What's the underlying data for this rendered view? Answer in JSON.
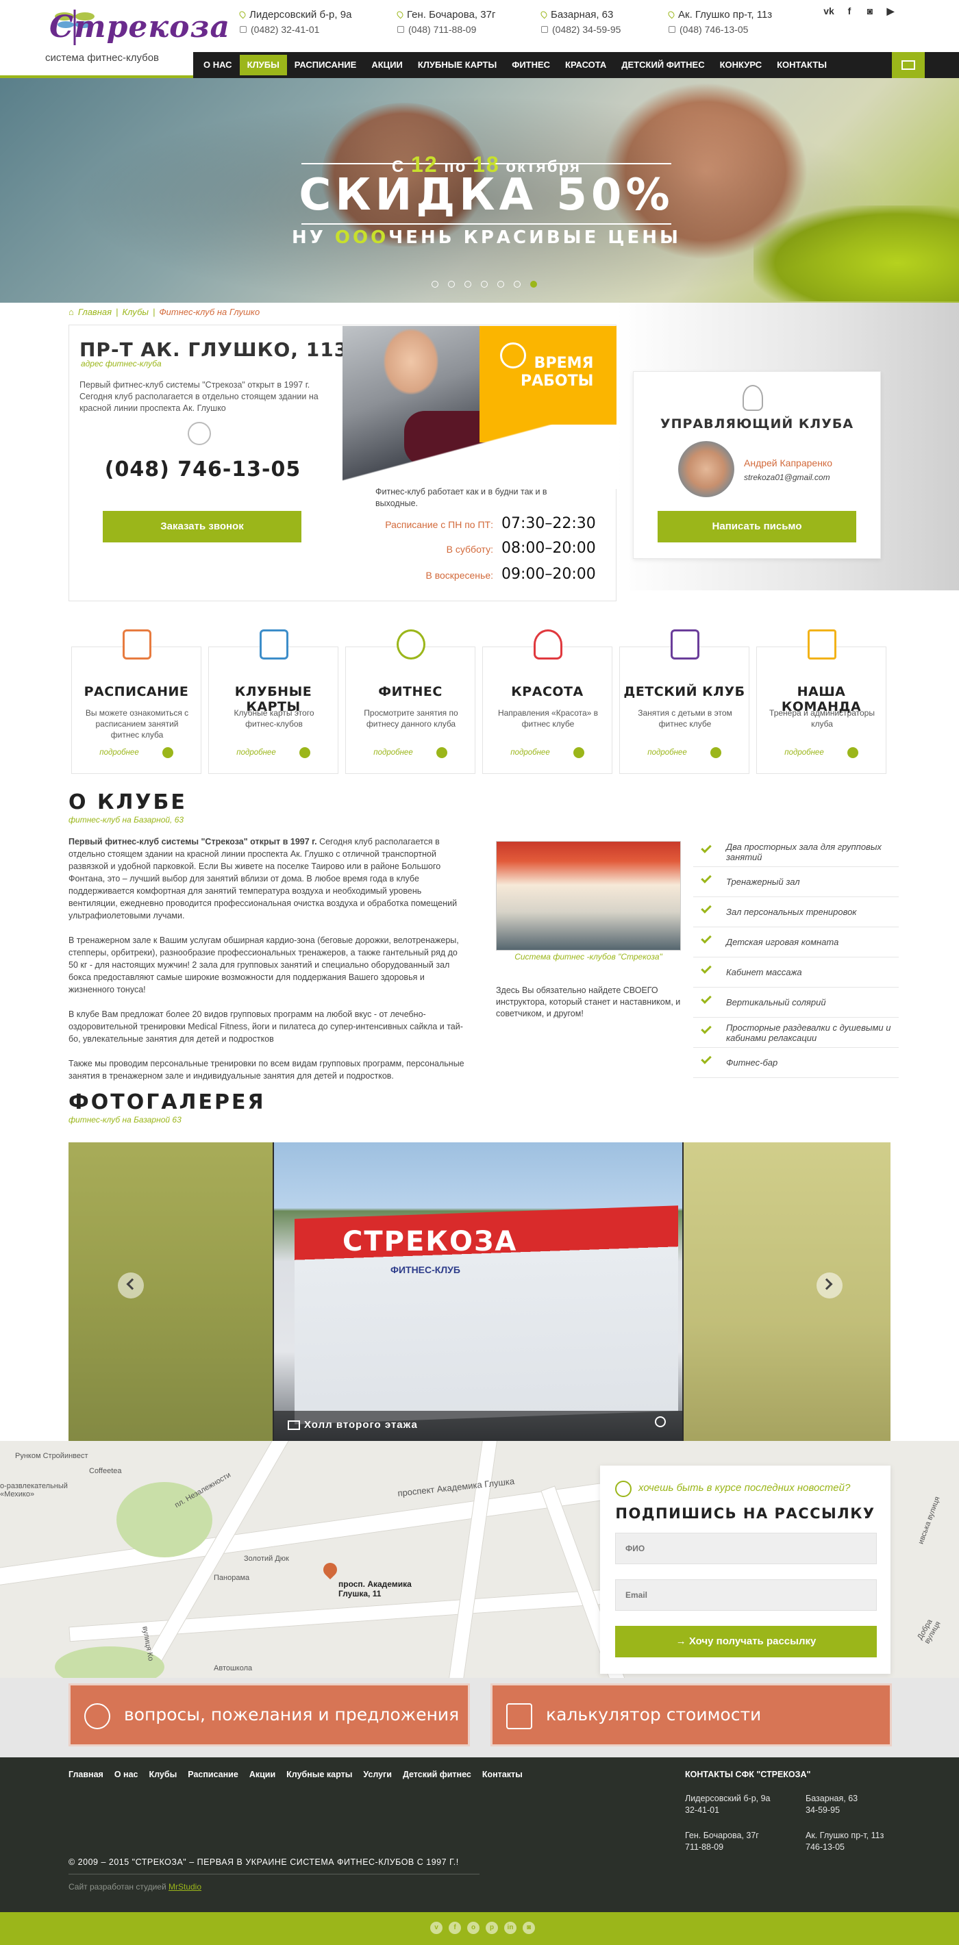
{
  "brand": {
    "name": "Стрекоза",
    "tagline": "система фитнес-клубов",
    "accent": "#9bb61a",
    "orange": "#d2693a"
  },
  "addresses": [
    {
      "street": "Лидерсовский б-р, 9а",
      "phone": "(0482) 32-41-01"
    },
    {
      "street": "Ген. Бочарова, 37г",
      "phone": "(048) 711-88-09"
    },
    {
      "street": "Базарная, 63",
      "phone": "(0482) 34-59-95"
    },
    {
      "street": "Ак. Глушко пр-т, 11з",
      "phone": "(048) 746-13-05"
    }
  ],
  "socials": [
    "vk-icon",
    "facebook-icon",
    "instagram-icon",
    "youtube-icon"
  ],
  "nav": [
    "О нас",
    "Клубы",
    "Расписание",
    "Акции",
    "Клубные карты",
    "Фитнес",
    "Красота",
    "Детский фитнес",
    "Конкурс",
    "Контакты"
  ],
  "nav_active": "Клубы",
  "hero": {
    "date_prefix": "С",
    "date_from": "12",
    "date_mid": "по",
    "date_to": "18",
    "date_month": "октября",
    "title": "СКИДКА 50%",
    "sub_pre": "НУ ",
    "sub_accent": "ООО",
    "sub_post": "ЧЕНЬ КРАСИВЫЕ ЦЕНЫ",
    "slides": 7,
    "active_slide": 7
  },
  "breadcrumb": {
    "home": "Главная",
    "clubs": "Клубы",
    "current": "Фитнес-клуб на Глушко"
  },
  "club": {
    "title": "ПР-Т АК. ГЛУШКО, 113",
    "addr_label": "адрес фитнес-клуба",
    "desc": "Первый фитнес-клуб системы \"Стрекоза\" открыт в 1997 г. Сегодня клуб располагается в отдельно стоящем здании на красной линии проспекта Ак. Глушко",
    "phone": "(048) 746-13-05",
    "callback": "Заказать звонок"
  },
  "hours": {
    "title1": "ВРЕМЯ",
    "title2": "РАБОТЫ",
    "note": "Фитнес-клуб работает как и в будни так и в выходные.",
    "rows": [
      {
        "label": "Расписание с ПН по ПТ:",
        "value": "07:30–22:30"
      },
      {
        "label": "В субботу:",
        "value": "08:00–20:00"
      },
      {
        "label": "В воскресенье:",
        "value": "09:00–20:00"
      }
    ]
  },
  "manager": {
    "title": "УПРАВЛЯЮЩИЙ КЛУБА",
    "name": "Андрей Капраренко",
    "email": "strekoza01@gmail.com",
    "button": "Написать письмо"
  },
  "features": [
    {
      "title": "РАСПИСАНИЕ",
      "desc": "Вы можете ознакомиться с расписанием занятий фитнес клуба",
      "icon": "clipboard-icon"
    },
    {
      "title": "КЛУБНЫЕ КАРТЫ",
      "desc": "Клубные карты этого фитнес-клубов",
      "icon": "card-icon"
    },
    {
      "title": "ФИТНЕС",
      "desc": "Просмотрите занятия по фитнесу данного клуба",
      "icon": "stopwatch-icon"
    },
    {
      "title": "КРАСОТА",
      "desc": "Направления «Красота» в фитнес клубе",
      "icon": "heartbeat-icon"
    },
    {
      "title": "ДЕТСКИЙ КЛУБ",
      "desc": "Занятия с детьми в этом фитнес клубе",
      "icon": "kids-icon"
    },
    {
      "title": "НАША КОМАНДА",
      "desc": "Тренера и администраторы клуба",
      "icon": "star-icon"
    }
  ],
  "more_label": "подробнее",
  "about": {
    "title": "О КЛУБЕ",
    "sub": "фитнес-клуб на Базарной, 63",
    "p1_bold": "Первый фитнес-клуб системы \"Стрекоза\" открыт в 1997 г.",
    "p1": " Сегодня клуб располагается в отдельно стоящем здании на красной линии проспекта Ак. Глушко с отличной транспортной развязкой и удобной парковкой. Если Вы живете на поселке Таирово или в районе Большого Фонтана, это – лучший выбор для занятий вблизи от дома. В любое время года в клубе поддерживается комфортная для занятий температура воздуха и необходимый уровень вентиляции, ежедневно проводится профессиональная очистка воздуха и обработка помещений ультрафиолетовыми лучами.",
    "p2": "В тренажерном зале к Вашим услугам обширная кардио-зона (беговые дорожки, велотренажеры, степперы, орбитреки), разнообразие профессиональных тренажеров, а также гантельный ряд до 50 кг - для настоящих мужчин! 2 зала для групповых занятий и специально оборудованный зал бокса предоставляют самые широкие возможности для поддержания Вашего здоровья и жизненного тонуса!",
    "p3": "В клубе Вам предложат более 20 видов групповых программ на любой вкус - от лечебно-оздоровительной тренировки Medical Fitness, йоги и пилатеса до супер-интенсивных сайкла и тай-бо, увлекательные занятия для детей и подростков",
    "p4": "Также мы проводим персональные тренировки по всем видам групповых программ, персональные занятия в тренажерном зале и индивидуальные занятия для детей и подростков.",
    "photo_caption": "Система фитнес -клубов \"Стрекоза\"",
    "note": "Здесь Вы обязательно найдете СВОЕГО инструктора, который станет и наставником, и советчиком, и другом!",
    "amenities": [
      "Два просторных зала для групповых занятий",
      "Тренажерный зал",
      "Зал персональных тренировок",
      "Детская игровая комната",
      "Кабинет массажа",
      "Вертикальный солярий",
      "Просторные раздевалки с душевыми и кабинами релаксации",
      "Фитнес-бар"
    ]
  },
  "gallery": {
    "title": "ФОТОГАЛЕРЕЯ",
    "sub": "фитнес-клуб на Базарной 63",
    "sign": "СТРЕКОЗА",
    "sign2": "ФИТНЕС-КЛУБ",
    "caption": "Холл второго этажа"
  },
  "map": {
    "labels": [
      "Рунком Стройинвест",
      "Coffeetea",
      "о-развлекательный «Мехико»",
      "пл. Незалежности",
      "проспект Академика Глушка",
      "Золотий Дюк",
      "Панорама",
      "вулиця Ко",
      "Автошкола",
      "Добра вулиця",
      "ивська вулиця"
    ],
    "marker": "просп. Академика Глушка, 11"
  },
  "newsletter": {
    "question": "хочешь быть в курсе последних новостей?",
    "title": "ПОДПИШИСЬ НА РАССЫЛКУ",
    "name_placeholder": "ФИО",
    "email_placeholder": "Email",
    "button": "Хочу получать рассылку"
  },
  "cta": {
    "questions": "вопросы, пожелания и предложения",
    "calculator": "калькулятор стоимости"
  },
  "footer": {
    "nav": [
      "Главная",
      "О нас",
      "Клубы",
      "Расписание",
      "Акции",
      "Клубные карты",
      "Услуги",
      "Детский фитнес",
      "Контакты"
    ],
    "contacts_title": "КОНТАКТЫ СФК \"СТРЕКОЗА\"",
    "contacts": [
      {
        "street": "Лидерсовский б-р, 9а",
        "phone": "32-41-01"
      },
      {
        "street": "Базарная, 63",
        "phone": "34-59-95"
      },
      {
        "street": "Ген. Бочарова, 37г",
        "phone": "711-88-09"
      },
      {
        "street": "Ак. Глушко пр-т, 11з",
        "phone": "746-13-05"
      }
    ],
    "copyright": "© 2009 – 2015 \"СТРЕКОЗА\" – ПЕРВАЯ В УКРАИНЕ СИСТЕМА ФИТНЕС-КЛУБОВ С 1997 Г.!",
    "made_by": "Сайт разработан студией ",
    "studio": "MrStudio",
    "bottom_socials": [
      "vk-icon",
      "facebook-icon",
      "odnoklassniki-icon",
      "pinterest-icon",
      "linkedin-icon",
      "instagram-icon"
    ]
  }
}
